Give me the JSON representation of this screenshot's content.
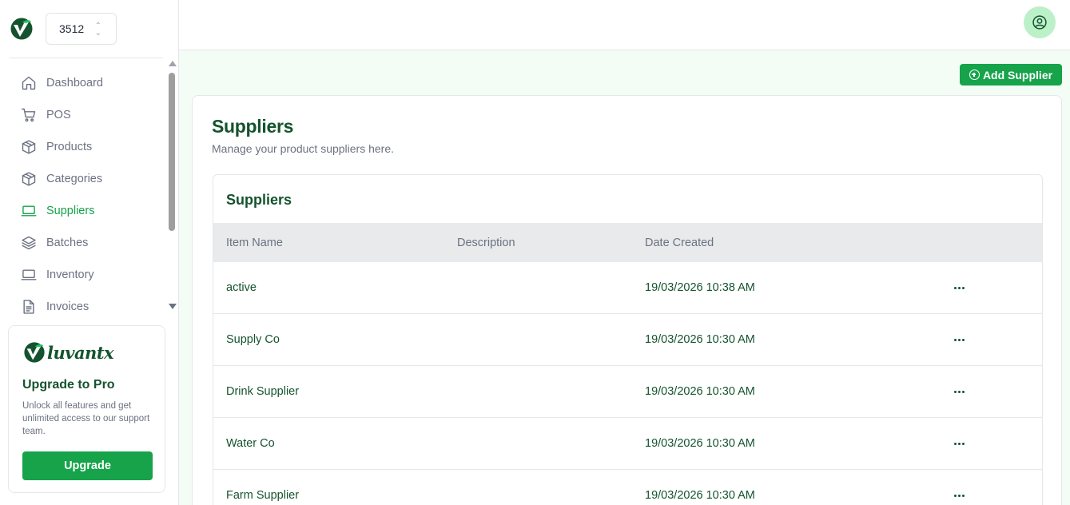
{
  "store": {
    "selected": "3512"
  },
  "sidebar": {
    "items": [
      {
        "label": "Dashboard",
        "icon": "home-icon",
        "active": false
      },
      {
        "label": "POS",
        "icon": "cart-icon",
        "active": false
      },
      {
        "label": "Products",
        "icon": "box-icon",
        "active": false
      },
      {
        "label": "Categories",
        "icon": "box-icon",
        "active": false
      },
      {
        "label": "Suppliers",
        "icon": "laptop-icon",
        "active": true
      },
      {
        "label": "Batches",
        "icon": "layers-icon",
        "active": false
      },
      {
        "label": "Inventory",
        "icon": "laptop-icon",
        "active": false
      },
      {
        "label": "Invoices",
        "icon": "document-icon",
        "active": false
      }
    ],
    "promo": {
      "brand": "luvantx",
      "title": "Upgrade to Pro",
      "text": "Unlock all features and get unlimited access to our support team.",
      "button": "Upgrade"
    }
  },
  "header": {
    "avatar_icon": "user-circle-icon"
  },
  "main": {
    "add_button": "Add Supplier",
    "title": "Suppliers",
    "subtitle": "Manage your product suppliers here.",
    "table": {
      "title": "Suppliers",
      "columns": [
        "Item Name",
        "Description",
        "Date Created"
      ],
      "rows": [
        {
          "name": "active",
          "description": "",
          "date": "19/03/2026 10:38 AM"
        },
        {
          "name": "Supply Co",
          "description": "",
          "date": "19/03/2026 10:30 AM"
        },
        {
          "name": "Drink Supplier",
          "description": "",
          "date": "19/03/2026 10:30 AM"
        },
        {
          "name": "Water Co",
          "description": "",
          "date": "19/03/2026 10:30 AM"
        },
        {
          "name": "Farm Supplier",
          "description": "",
          "date": "19/03/2026 10:30 AM"
        }
      ]
    }
  },
  "colors": {
    "accent": "#16a34a",
    "brand_dark": "#14532d",
    "main_bg": "#f3fcf5"
  }
}
